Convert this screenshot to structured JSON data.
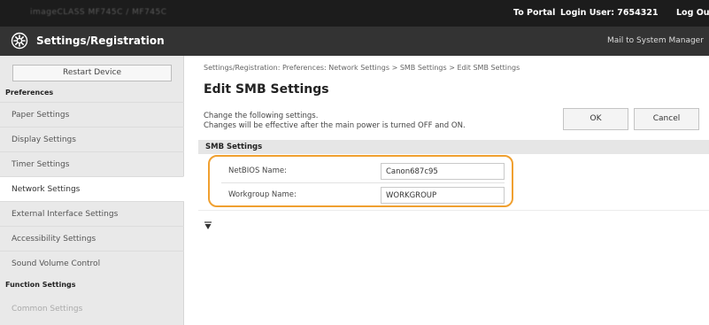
{
  "topbar": {
    "device_name": "imageCLASS MF745C / MF745C",
    "to_portal": "To Portal",
    "login_user": "Login User: 7654321",
    "logout": "Log Out"
  },
  "titlebar": {
    "title": "Settings/Registration",
    "mail_link": "Mail to System Manager"
  },
  "sidebar": {
    "restart_label": "Restart Device",
    "preferences_heading": "Preferences",
    "items": [
      {
        "label": "Paper Settings"
      },
      {
        "label": "Display Settings"
      },
      {
        "label": "Timer Settings"
      },
      {
        "label": "Network Settings"
      },
      {
        "label": "External Interface Settings"
      },
      {
        "label": "Accessibility Settings"
      },
      {
        "label": "Sound Volume Control"
      }
    ],
    "function_heading": "Function Settings",
    "function_items": [
      {
        "label": "Common Settings"
      }
    ]
  },
  "main": {
    "breadcrumb": "Settings/Registration: Preferences: Network Settings > SMB Settings > Edit SMB Settings",
    "page_title": "Edit SMB Settings",
    "desc_line1": "Change the following settings.",
    "desc_line2": "Changes will be effective after the main power is turned OFF and ON.",
    "ok_label": "OK",
    "cancel_label": "Cancel",
    "section_title": "SMB Settings",
    "fields": {
      "netbios_label": "NetBIOS Name:",
      "netbios_value": "Canon687c95",
      "workgroup_label": "Workgroup Name:",
      "workgroup_value": "WORKGROUP"
    }
  },
  "colors": {
    "topbar_bg": "#1c1c1c",
    "titlebar_bg": "#333333",
    "sidebar_bg": "#e9e9e9",
    "highlight": "#f0a030"
  }
}
